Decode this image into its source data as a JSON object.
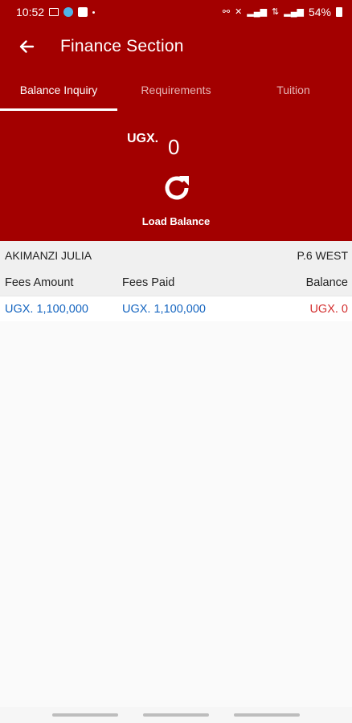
{
  "status_bar": {
    "time": "10:52",
    "battery": "54%"
  },
  "app_bar": {
    "title": "Finance Section"
  },
  "tabs": [
    {
      "label": "Balance Inquiry",
      "active": true
    },
    {
      "label": "Requirements",
      "active": false
    },
    {
      "label": "Tuition",
      "active": false
    }
  ],
  "balance": {
    "currency": "UGX.",
    "amount": "0",
    "load_label": "Load Balance"
  },
  "student": {
    "name": "AKIMANZI JULIA",
    "class": "P.6 WEST"
  },
  "fees_table": {
    "headers": [
      "Fees Amount",
      "Fees Paid",
      "Balance"
    ],
    "values": [
      "UGX. 1,100,000",
      "UGX. 1,100,000",
      "UGX. 0"
    ]
  },
  "colors": {
    "primary": "#a30000",
    "value_blue": "#1565c0",
    "balance_red": "#d32f2f"
  }
}
